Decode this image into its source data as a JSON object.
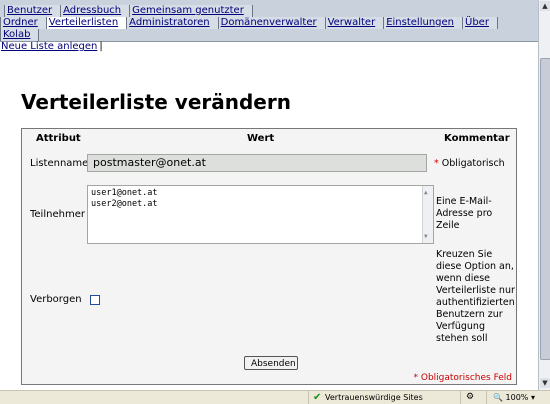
{
  "nav": {
    "row1": [
      "Benutzer",
      "Adressbuch",
      "Gemeinsam genutzter"
    ],
    "row2": [
      "Ordner",
      "Verteilerlisten",
      "Administratoren",
      "Domänenverwalter",
      "Verwalter",
      "Einstellungen",
      "Über"
    ],
    "row3": [
      "Kolab"
    ],
    "active": "Verteilerlisten"
  },
  "subnav": {
    "new_list": "Neue Liste anlegen",
    "sep": "|"
  },
  "page_title": "Verteilerliste verändern",
  "form": {
    "col_attribute": "Attribut",
    "col_value": "Wert",
    "col_comment": "Kommentar",
    "listname_label": "Listenname",
    "listname_value": "postmaster@onet.at",
    "listname_comment": "Obligatorisch",
    "members_label": "Teilnehmer",
    "members": [
      "user1@onet.at",
      "user2@onet.at"
    ],
    "members_comment": "Eine E-Mail-Adresse pro Zeile",
    "hidden_label": "Verborgen",
    "hidden_checked": false,
    "hidden_comment": "Kreuzen Sie diese Option an, wenn diese Verteilerliste nur authentifizierten Benutzern zur Verfügung stehen soll",
    "submit": "Absenden",
    "required_note": "Obligatorisches Feld",
    "required_star": "*"
  },
  "statusbar": {
    "zone": "Vertrauenswürdige Sites",
    "zoom": "100%"
  },
  "colors": {
    "accent": "#00007a",
    "required": "#cc0000",
    "nav_bg": "#c9d1dc"
  }
}
